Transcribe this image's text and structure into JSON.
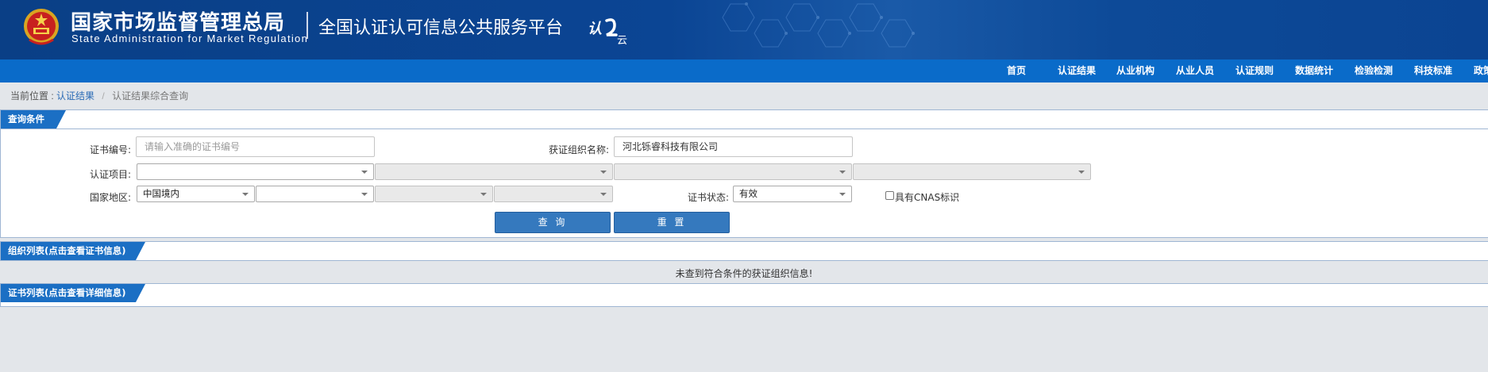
{
  "header": {
    "org_cn": "国家市场监督管理总局",
    "org_en": "State Administration  for  Market Regulation",
    "platform": "全国认证认可信息公共服务平台",
    "logo_text": "认云",
    "brand_color": "#0b4594"
  },
  "nav": {
    "items": [
      "首页",
      "认证结果",
      "从业机构",
      "从业人员",
      "认证规则",
      "数据统计",
      "检验检测",
      "科技标准",
      "政策"
    ]
  },
  "breadcrumb": {
    "prefix": "当前位置 :",
    "link": "认证结果",
    "separator": "/",
    "current": "认证结果综合查询"
  },
  "query": {
    "title": "查询条件",
    "cert_no_label": "证书编号:",
    "cert_no_placeholder": "请输入准确的证书编号",
    "org_name_label": "获证组织名称:",
    "org_name_value": "河北铄睿科技有限公司",
    "project_label": "认证项目:",
    "region_label": "国家地区:",
    "region_value": "中国境内",
    "status_label": "证书状态:",
    "status_value": "有效",
    "cnas_label": "具有CNAS标识",
    "search_button": "查 询",
    "reset_button": "重 置"
  },
  "org_list": {
    "title": "组织列表(点击查看证书信息)",
    "empty_message": "未查到符合条件的获证组织信息!"
  },
  "cert_list": {
    "title": "证书列表(点击查看详细信息)"
  },
  "colors": {
    "nav": "#0a6bc9",
    "tab": "#1b6fc4",
    "button": "#3579be",
    "page_bg": "#e3e6ea"
  }
}
